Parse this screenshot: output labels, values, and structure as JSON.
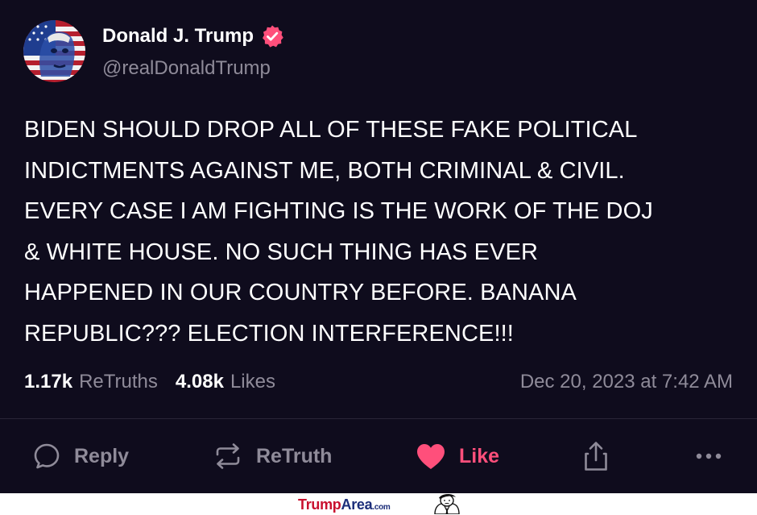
{
  "post": {
    "author": {
      "display_name": "Donald J. Trump",
      "handle": "@realDonaldTrump",
      "verified": true,
      "avatar_icon": "avatar-flag-portrait"
    },
    "text": "BIDEN SHOULD DROP ALL OF THESE FAKE POLITICAL\nINDICTMENTS AGAINST ME, BOTH CRIMINAL & CIVIL.\nEVERY CASE I AM FIGHTING IS THE WORK OF THE DOJ\n& WHITE HOUSE. NO SUCH THING HAS EVER\nHAPPENED IN OUR COUNTRY BEFORE. BANANA\nREPUBLIC??? ELECTION INTERFERENCE!!!",
    "stats": {
      "retruths_count": "1.17k",
      "retruths_label": "ReTruths",
      "likes_count": "4.08k",
      "likes_label": "Likes"
    },
    "timestamp": "Dec 20, 2023 at 7:42 AM"
  },
  "actions": {
    "reply_label": "Reply",
    "retruth_label": "ReTruth",
    "like_label": "Like",
    "like_active": true,
    "share_icon": "share-icon",
    "more_icon": "more-icon"
  },
  "watermark": {
    "part1": "Trump",
    "part2": "Area",
    "suffix": ".com"
  },
  "colors": {
    "background": "#0f0c1d",
    "text_primary": "#ffffff",
    "text_secondary": "#8f8b99",
    "like_accent": "#ff4f7b",
    "verified_badge": "#ff4f7b"
  }
}
